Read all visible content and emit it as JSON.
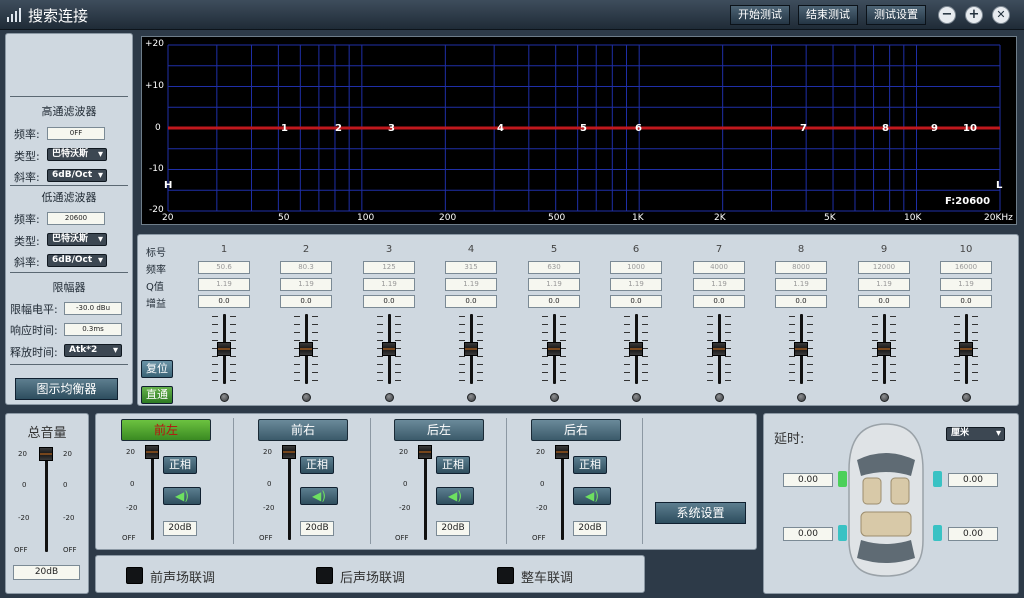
{
  "title_bar": {
    "title": "搜索连接",
    "start_test": "开始测试",
    "end_test": "结束测试",
    "test_settings": "测试设置",
    "minimize_glyph": "−",
    "maximize_glyph": "+",
    "close_glyph": "✕"
  },
  "filter_panel": {
    "highpass_title": "高通滤波器",
    "hp_freq_label": "频率:",
    "hp_freq_value": "0FF",
    "hp_type_label": "类型:",
    "hp_type_value": "巴特沃斯",
    "hp_slope_label": "斜率:",
    "hp_slope_value": "6dB/Oct",
    "lowpass_title": "低通滤波器",
    "lp_freq_label": "频率:",
    "lp_freq_value": "20600",
    "lp_type_label": "类型:",
    "lp_type_value": "巴特沃斯",
    "lp_slope_label": "斜率:",
    "lp_slope_value": "6dB/Oct",
    "limiter_title": "限幅器",
    "limit_level_label": "限幅电平:",
    "limit_level_value": "-30.0 dBu",
    "response_label": "响应时间:",
    "response_value": "0.3ms",
    "release_label": "释放时间:",
    "release_value": "Atk*2",
    "graphic_eq_button": "图示均衡器"
  },
  "graph": {
    "y_ticks": [
      "+20",
      "+10",
      "0",
      "-10",
      "-20"
    ],
    "x_ticks": [
      "20",
      "50",
      "100",
      "200",
      "500",
      "1K",
      "2K",
      "5K",
      "10K",
      "20KHz"
    ],
    "h_marker": "H",
    "l_marker": "L",
    "freq_readout": "F:20600",
    "band_labels": [
      "1",
      "2",
      "3",
      "4",
      "5",
      "6",
      "7",
      "8",
      "9",
      "10"
    ]
  },
  "eq_bands": {
    "row_labels": {
      "index": "标号",
      "freq": "频率",
      "q": "Q值",
      "gain": "增益"
    },
    "reset_button": "复位",
    "bypass_button": "直通",
    "bands": [
      {
        "index": "1",
        "freq": "50.6",
        "q": "1.19",
        "gain": "0.0"
      },
      {
        "index": "2",
        "freq": "80.3",
        "q": "1.19",
        "gain": "0.0"
      },
      {
        "index": "3",
        "freq": "125",
        "q": "1.19",
        "gain": "0.0"
      },
      {
        "index": "4",
        "freq": "315",
        "q": "1.19",
        "gain": "0.0"
      },
      {
        "index": "5",
        "freq": "630",
        "q": "1.19",
        "gain": "0.0"
      },
      {
        "index": "6",
        "freq": "1000",
        "q": "1.19",
        "gain": "0.0"
      },
      {
        "index": "7",
        "freq": "4000",
        "q": "1.19",
        "gain": "0.0"
      },
      {
        "index": "8",
        "freq": "8000",
        "q": "1.19",
        "gain": "0.0"
      },
      {
        "index": "9",
        "freq": "12000",
        "q": "1.19",
        "gain": "0.0"
      },
      {
        "index": "10",
        "freq": "16000",
        "q": "1.19",
        "gain": "0.0"
      }
    ]
  },
  "master": {
    "title": "总音量",
    "value": "20dB",
    "scale": [
      "20",
      "0",
      "-20",
      "OFF"
    ]
  },
  "channels": {
    "scale": [
      "20",
      "0",
      "-20",
      "OFF"
    ],
    "items": [
      {
        "name": "前左",
        "active": true,
        "phase": "正相",
        "value": "20dB"
      },
      {
        "name": "前右",
        "active": false,
        "phase": "正相",
        "value": "20dB"
      },
      {
        "name": "后左",
        "active": false,
        "phase": "正相",
        "value": "20dB"
      },
      {
        "name": "后右",
        "active": false,
        "phase": "正相",
        "value": "20dB"
      }
    ],
    "system_settings": "系统设置"
  },
  "linking": {
    "front": "前声场联调",
    "rear": "后声场联调",
    "whole": "整车联调"
  },
  "delay": {
    "title": "延时:",
    "unit": "厘米",
    "fl": "0.00",
    "fr": "0.00",
    "rl": "0.00",
    "rr": "0.00"
  },
  "colors": {
    "active_channel": "#5bae2f",
    "curve": "#c0181d",
    "knob_accent": "#d2701e"
  }
}
